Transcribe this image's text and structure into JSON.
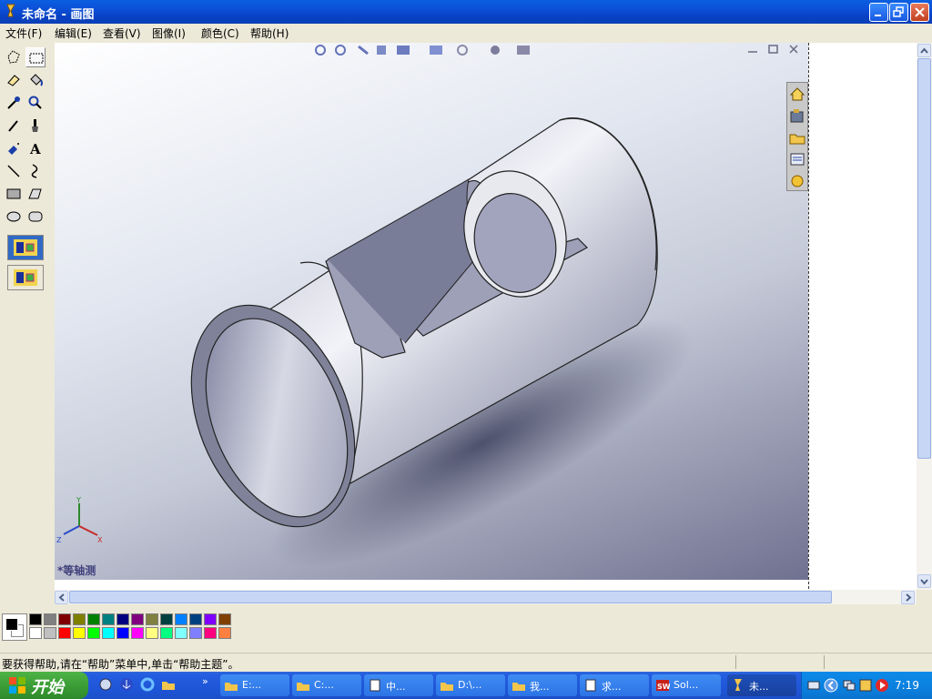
{
  "window": {
    "title": "未命名 - 画图"
  },
  "menu": [
    {
      "label": "文件(F)"
    },
    {
      "label": "编辑(E)"
    },
    {
      "label": "查看(V)"
    },
    {
      "label": "图像(I)"
    },
    {
      "label": "颜色(C)"
    },
    {
      "label": "帮助(H)"
    }
  ],
  "toolbox": {
    "tools": [
      "free-select",
      "rect-select",
      "eraser",
      "fill",
      "color-picker",
      "magnifier",
      "pencil",
      "brush",
      "airbrush",
      "text",
      "line",
      "curve",
      "rectangle",
      "polygon",
      "ellipse",
      "rounded-rectangle"
    ]
  },
  "canvas": {
    "view_label": "*等轴测",
    "axis_labels": {
      "y": "Y",
      "x": "X",
      "z": "Z"
    },
    "right_panel_icons": [
      "home-icon",
      "library-icon",
      "folder-icon",
      "properties-icon",
      "appearance-icon"
    ],
    "toolbar_icons": [
      "zoom-fit-icon",
      "zoom-area-icon",
      "rotate-icon",
      "section-icon",
      "view-orient-icon",
      "display-style-icon",
      "hide-show-icon",
      "edit-appearance-icon",
      "scene-icon"
    ]
  },
  "palette": {
    "foreground": "#000000",
    "background": "#ffffff",
    "top_row": [
      "#000000",
      "#808080",
      "#800000",
      "#808000",
      "#008000",
      "#008080",
      "#000080",
      "#800080",
      "#808040",
      "#004040",
      "#0080ff",
      "#004080",
      "#8000ff",
      "#804000"
    ],
    "bottom_row": [
      "#ffffff",
      "#c0c0c0",
      "#ff0000",
      "#ffff00",
      "#00ff00",
      "#00ffff",
      "#0000ff",
      "#ff00ff",
      "#ffff80",
      "#00ff80",
      "#80ffff",
      "#8080ff",
      "#ff0080",
      "#ff8040"
    ]
  },
  "status": {
    "text": "要获得帮助,请在“帮助”菜单中,单击“帮助主题”。"
  },
  "taskbar": {
    "start_label": "开始",
    "buttons": [
      {
        "label": "E:..."
      },
      {
        "label": "C:..."
      },
      {
        "label": "中..."
      },
      {
        "label": "D:\\..."
      },
      {
        "label": "我..."
      },
      {
        "label": "求..."
      },
      {
        "label": "Sol..."
      },
      {
        "label": "未..."
      }
    ],
    "clock": "7:19"
  }
}
